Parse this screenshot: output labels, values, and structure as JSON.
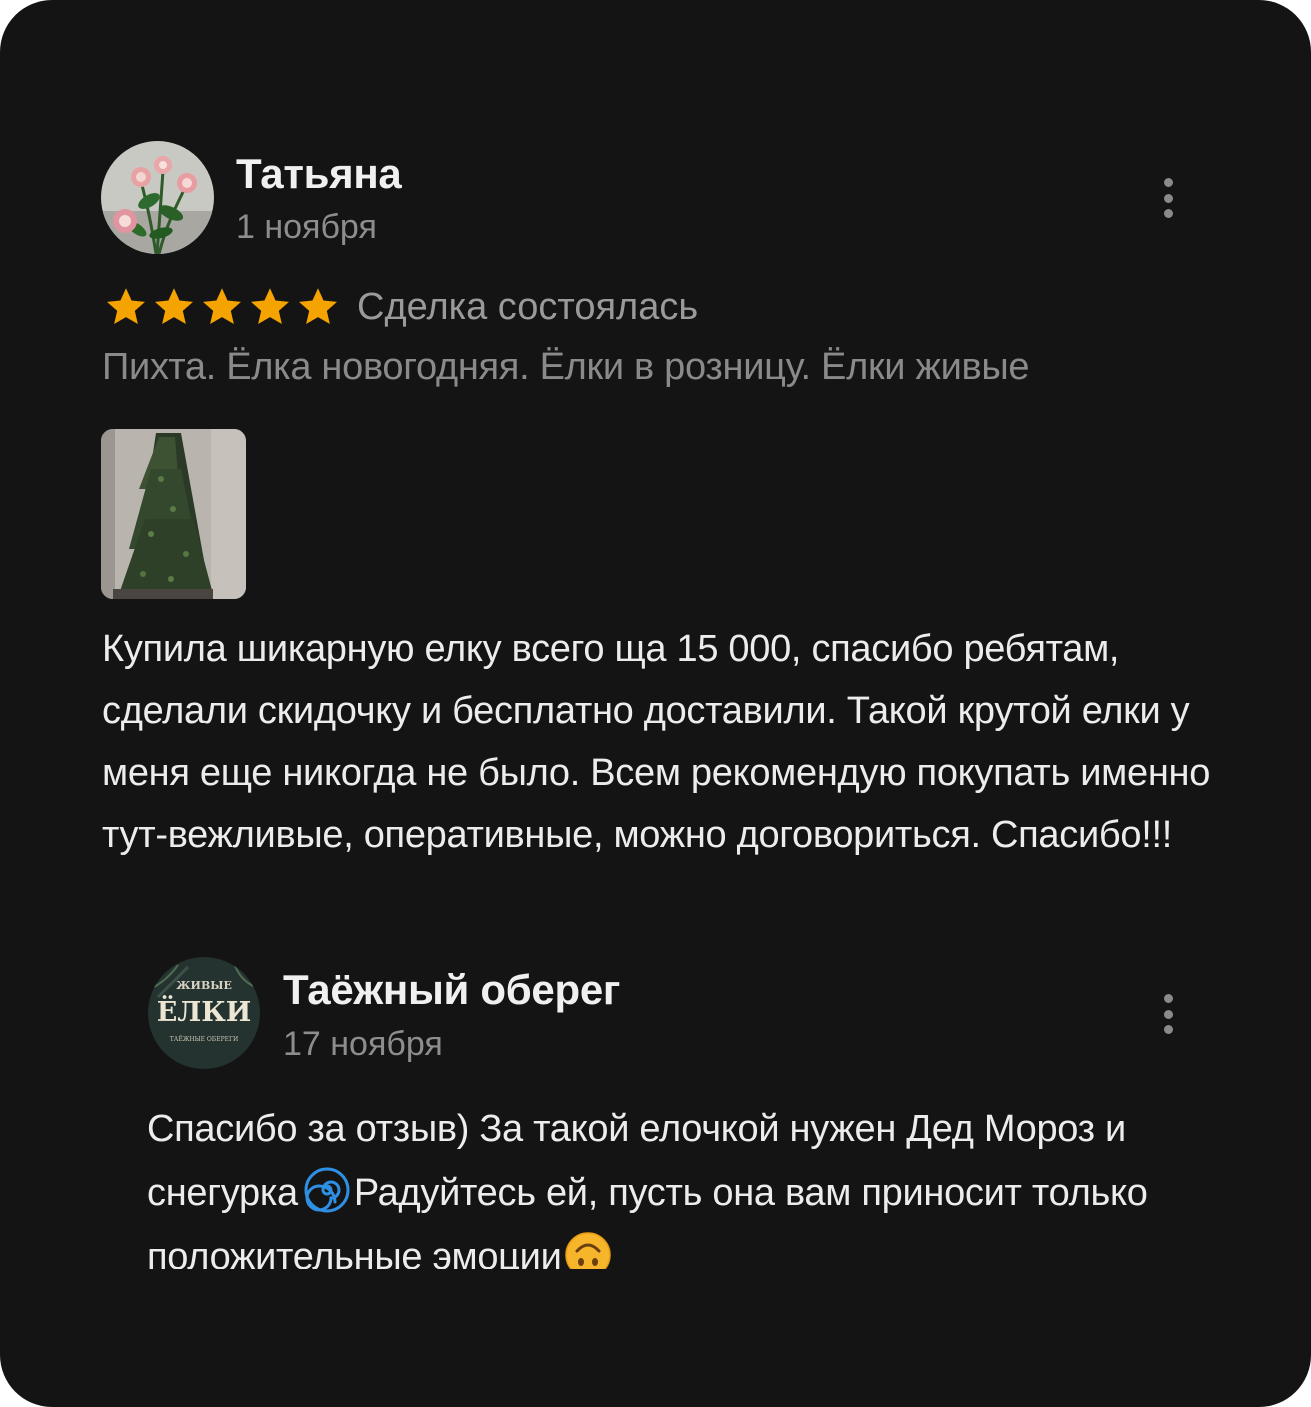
{
  "review": {
    "author": "Татьяна",
    "date": "1 ноября",
    "rating": 5,
    "rating_max": 5,
    "deal_status": "Сделка состоялась",
    "product_title": "Пихта. Ёлка новогодняя. Ёлки в розницу. Ёлки живые",
    "text": "Купила шикарную елку всего ща 15 000, спасибо ребятам, сделали скидочку и бесплатно доставили. Такой крутой елки у меня еще никогда не было. Всем рекомендую покупать именно тут-вежливые, оперативные, можно договориться. Спасибо!!!"
  },
  "reply": {
    "author": "Таёжный оберег",
    "date": "17 ноября",
    "avatar_text_top": "ЖИВЫЕ",
    "avatar_text_main": "ЁЛКИ",
    "avatar_text_bottom": "ТАЁЖНЫЕ ОБЕРЕГИ",
    "text_part1": "Спасибо за отзыв) За такой елочкой нужен Дед Мороз и снегурка",
    "emoji_1": "cyclone-emoji",
    "text_part2": "Радуйтесь ей, пусть она вам приносит только положительные эмоции",
    "emoji_2": "upside-down-face-emoji"
  },
  "colors": {
    "background": "#141414",
    "star": "#f5a300",
    "primary_text": "#ececec",
    "secondary_text": "#8d8d8d"
  },
  "icons": {
    "more": "more-vertical-icon",
    "star": "star-icon"
  }
}
